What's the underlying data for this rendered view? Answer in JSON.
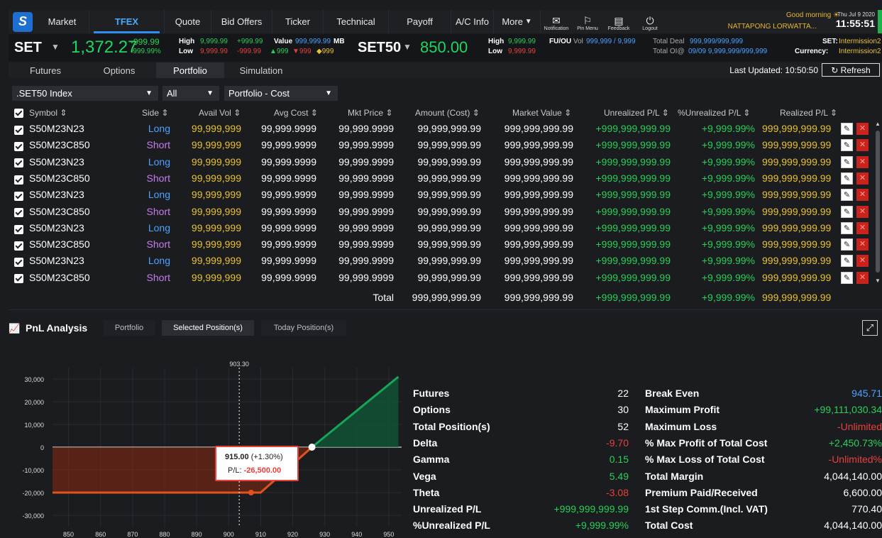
{
  "nav": {
    "items": [
      "Market",
      "TFEX",
      "Quote",
      "Bid Offers",
      "Ticker",
      "Technical",
      "Payoff",
      "A/C Info",
      "More"
    ],
    "active": "TFEX",
    "icons": [
      {
        "label": "Notification",
        "icon": "mail-icon",
        "glyph": "✉"
      },
      {
        "label": "Pin Menu",
        "icon": "bookmark-icon",
        "glyph": "⚐"
      },
      {
        "label": "Feedback",
        "icon": "chat-icon",
        "glyph": "▤"
      },
      {
        "label": "Logout",
        "icon": "power-icon",
        "glyph": "⏻"
      }
    ],
    "greeting": "Good morning",
    "user": "NATTAPONG LORWATTA...",
    "date": "Thu Jul 9 2020",
    "time": "11:55:51"
  },
  "index": {
    "set_name": "SET",
    "set_value": "1,372.27",
    "set_change": "-999.99",
    "set_change_pct": "-999.99%",
    "high_label": "High",
    "low_label": "Low",
    "high_value": "9,999.99",
    "high_change": "+999.99",
    "low_value": "9,999.99",
    "low_change": "-999.99",
    "value_label": "Value",
    "value_value": "999,999.99",
    "value_unit": "MB",
    "up_count": "▲999",
    "down_count": "▼999",
    "unch_count": "◆999",
    "set50_name": "SET50",
    "set50_value": "850.00",
    "s50_high_label": "High",
    "s50_high": "9,999.99",
    "s50_low_label": "Low",
    "s50_low": "9,999.99",
    "fuou_label": "FU/OU",
    "vol_label": "Vol",
    "vol_value": "999,999 / 9,999",
    "total_deal_label": "Total Deal",
    "total_deal_value": "999,999/999,999",
    "total_oi_label": "Total OI@",
    "total_oi_value": "09/09 9,999,999/999,999",
    "set_status_label": "SET:",
    "set_status": "Intermission2",
    "currency_label": "Currency:",
    "currency_status": "Intermission2"
  },
  "subtabs": [
    "Futures",
    "Options",
    "Portfolio",
    "Simulation"
  ],
  "active_subtab": "Portfolio",
  "last_updated": "Last Updated: 10:50:50",
  "refresh_label": "Refresh",
  "filters": {
    "index": ".SET50 Index",
    "side": "All",
    "mode": "Portfolio - Cost"
  },
  "table": {
    "headers": [
      "Symbol ⇕",
      "Side ⇕",
      "Avail Vol ⇕",
      "Avg Cost ⇕",
      "Mkt Price ⇕",
      "Amount (Cost) ⇕",
      "Market Value ⇕",
      "Unrealized P/L ⇕",
      "%Unrealized P/L ⇕",
      "Realized P/L ⇕"
    ],
    "rows": [
      {
        "symbol": "S50M23N23",
        "side": "Long",
        "avail": "99,999,999",
        "avg": "99,999.9999",
        "mkt": "99,999.9999",
        "amount": "99,999,999.99",
        "mv": "999,999,999.99",
        "upl": "+999,999,999.99",
        "upct": "+9,999.99%",
        "rpl": "999,999,999.99"
      },
      {
        "symbol": "S50M23C850",
        "side": "Short",
        "avail": "99,999,999",
        "avg": "99,999.9999",
        "mkt": "99,999.9999",
        "amount": "99,999,999.99",
        "mv": "999,999,999.99",
        "upl": "+999,999,999.99",
        "upct": "+9,999.99%",
        "rpl": "999,999,999.99"
      },
      {
        "symbol": "S50M23N23",
        "side": "Long",
        "avail": "99,999,999",
        "avg": "99,999.9999",
        "mkt": "99,999.9999",
        "amount": "99,999,999.99",
        "mv": "999,999,999.99",
        "upl": "+999,999,999.99",
        "upct": "+9,999.99%",
        "rpl": "999,999,999.99"
      },
      {
        "symbol": "S50M23C850",
        "side": "Short",
        "avail": "99,999,999",
        "avg": "99,999.9999",
        "mkt": "99,999.9999",
        "amount": "99,999,999.99",
        "mv": "999,999,999.99",
        "upl": "+999,999,999.99",
        "upct": "+9,999.99%",
        "rpl": "999,999,999.99"
      },
      {
        "symbol": "S50M23N23",
        "side": "Long",
        "avail": "99,999,999",
        "avg": "99,999.9999",
        "mkt": "99,999.9999",
        "amount": "99,999,999.99",
        "mv": "999,999,999.99",
        "upl": "+999,999,999.99",
        "upct": "+9,999.99%",
        "rpl": "999,999,999.99"
      },
      {
        "symbol": "S50M23C850",
        "side": "Short",
        "avail": "99,999,999",
        "avg": "99,999.9999",
        "mkt": "99,999.9999",
        "amount": "99,999,999.99",
        "mv": "999,999,999.99",
        "upl": "+999,999,999.99",
        "upct": "+9,999.99%",
        "rpl": "999,999,999.99"
      },
      {
        "symbol": "S50M23N23",
        "side": "Long",
        "avail": "99,999,999",
        "avg": "99,999.9999",
        "mkt": "99,999.9999",
        "amount": "99,999,999.99",
        "mv": "999,999,999.99",
        "upl": "+999,999,999.99",
        "upct": "+9,999.99%",
        "rpl": "999,999,999.99"
      },
      {
        "symbol": "S50M23C850",
        "side": "Short",
        "avail": "99,999,999",
        "avg": "99,999.9999",
        "mkt": "99,999.9999",
        "amount": "99,999,999.99",
        "mv": "999,999,999.99",
        "upl": "+999,999,999.99",
        "upct": "+9,999.99%",
        "rpl": "999,999,999.99"
      },
      {
        "symbol": "S50M23N23",
        "side": "Long",
        "avail": "99,999,999",
        "avg": "99,999.9999",
        "mkt": "99,999.9999",
        "amount": "99,999,999.99",
        "mv": "999,999,999.99",
        "upl": "+999,999,999.99",
        "upct": "+9,999.99%",
        "rpl": "999,999,999.99"
      },
      {
        "symbol": "S50M23C850",
        "side": "Short",
        "avail": "99,999,999",
        "avg": "99,999.9999",
        "mkt": "99,999.9999",
        "amount": "99,999,999.99",
        "mv": "999,999,999.99",
        "upl": "+999,999,999.99",
        "upct": "+9,999.99%",
        "rpl": "999,999,999.99"
      }
    ],
    "total": {
      "label": "Total",
      "amount": "999,999,999.99",
      "mv": "999,999,999.99",
      "upl": "+999,999,999.99",
      "upct": "+9,999.99%",
      "rpl": "999,999,999.99"
    }
  },
  "pnl": {
    "title": "PnL Analysis",
    "tabs": [
      "Portfolio",
      "Selected Position(s)",
      "Today Position(s)"
    ],
    "active_tab": "Selected Position(s)",
    "tooltip_price": "915.00",
    "tooltip_pct": "(+1.30%)",
    "tooltip_pl_label": "P/L:",
    "tooltip_pl": "-26,500.00",
    "marker_label": "903.30",
    "left_stats": [
      {
        "label": "Futures",
        "value": "22",
        "color": "#ffffff"
      },
      {
        "label": "Options",
        "value": "30",
        "color": "#ffffff"
      },
      {
        "label": "Total Position(s)",
        "value": "52",
        "color": "#ffffff"
      },
      {
        "label": "Delta",
        "value": "-9.70",
        "color": "#e8403b"
      },
      {
        "label": "Gamma",
        "value": "0.15",
        "color": "#27d157"
      },
      {
        "label": "Vega",
        "value": "5.49",
        "color": "#27d157"
      },
      {
        "label": "Theta",
        "value": "-3.08",
        "color": "#e8403b"
      },
      {
        "label": "Unrealized P/L",
        "value": "+999,999,999.99",
        "color": "#27d157"
      },
      {
        "label": "%Unrealized P/L",
        "value": "+9,999.99%",
        "color": "#27d157"
      }
    ],
    "right_stats": [
      {
        "label": "Break Even",
        "value": "945.71",
        "color": "#4aa3ff"
      },
      {
        "label": "Maximum Profit",
        "value": "+99,111,030.34",
        "color": "#27d157"
      },
      {
        "label": "Maximum Loss",
        "value": "-Unlimited",
        "color": "#e8403b"
      },
      {
        "label": "% Max Profit of Total Cost",
        "value": "+2,450.73%",
        "color": "#27d157"
      },
      {
        "label": "% Max Loss of Total Cost",
        "value": "-Unlimited%",
        "color": "#e8403b"
      },
      {
        "label": "Total Margin",
        "value": "4,044,140.00",
        "color": "#ffffff"
      },
      {
        "label": "Premium Paid/Received",
        "value": "6,600.00",
        "color": "#ffffff"
      },
      {
        "label": "1st Step Comm.(Incl. VAT)",
        "value": "770.40",
        "color": "#ffffff"
      },
      {
        "label": "Total Cost",
        "value": "4,044,140.00",
        "color": "#ffffff"
      }
    ]
  },
  "chart_data": {
    "type": "line",
    "x_ticks": [
      850,
      860,
      870,
      880,
      890,
      900,
      910,
      920,
      930,
      940,
      950
    ],
    "y_ticks": [
      30000,
      20000,
      10000,
      0,
      -10000,
      -20000,
      -30000
    ],
    "y_tick_labels": [
      "30,000",
      "20,000",
      "10,000",
      "0",
      "-10,000",
      "-20,000",
      "-30,000"
    ],
    "xlim": [
      845,
      954
    ],
    "ylim": [
      -35000,
      35000
    ],
    "x": [
      845,
      910,
      926,
      953
    ],
    "y": [
      -20000,
      -20000,
      0,
      31000
    ],
    "highlight_points": [
      {
        "x": 907,
        "y": -20000
      },
      {
        "x": 926,
        "y": 0
      }
    ],
    "vline_x": 903.3
  }
}
